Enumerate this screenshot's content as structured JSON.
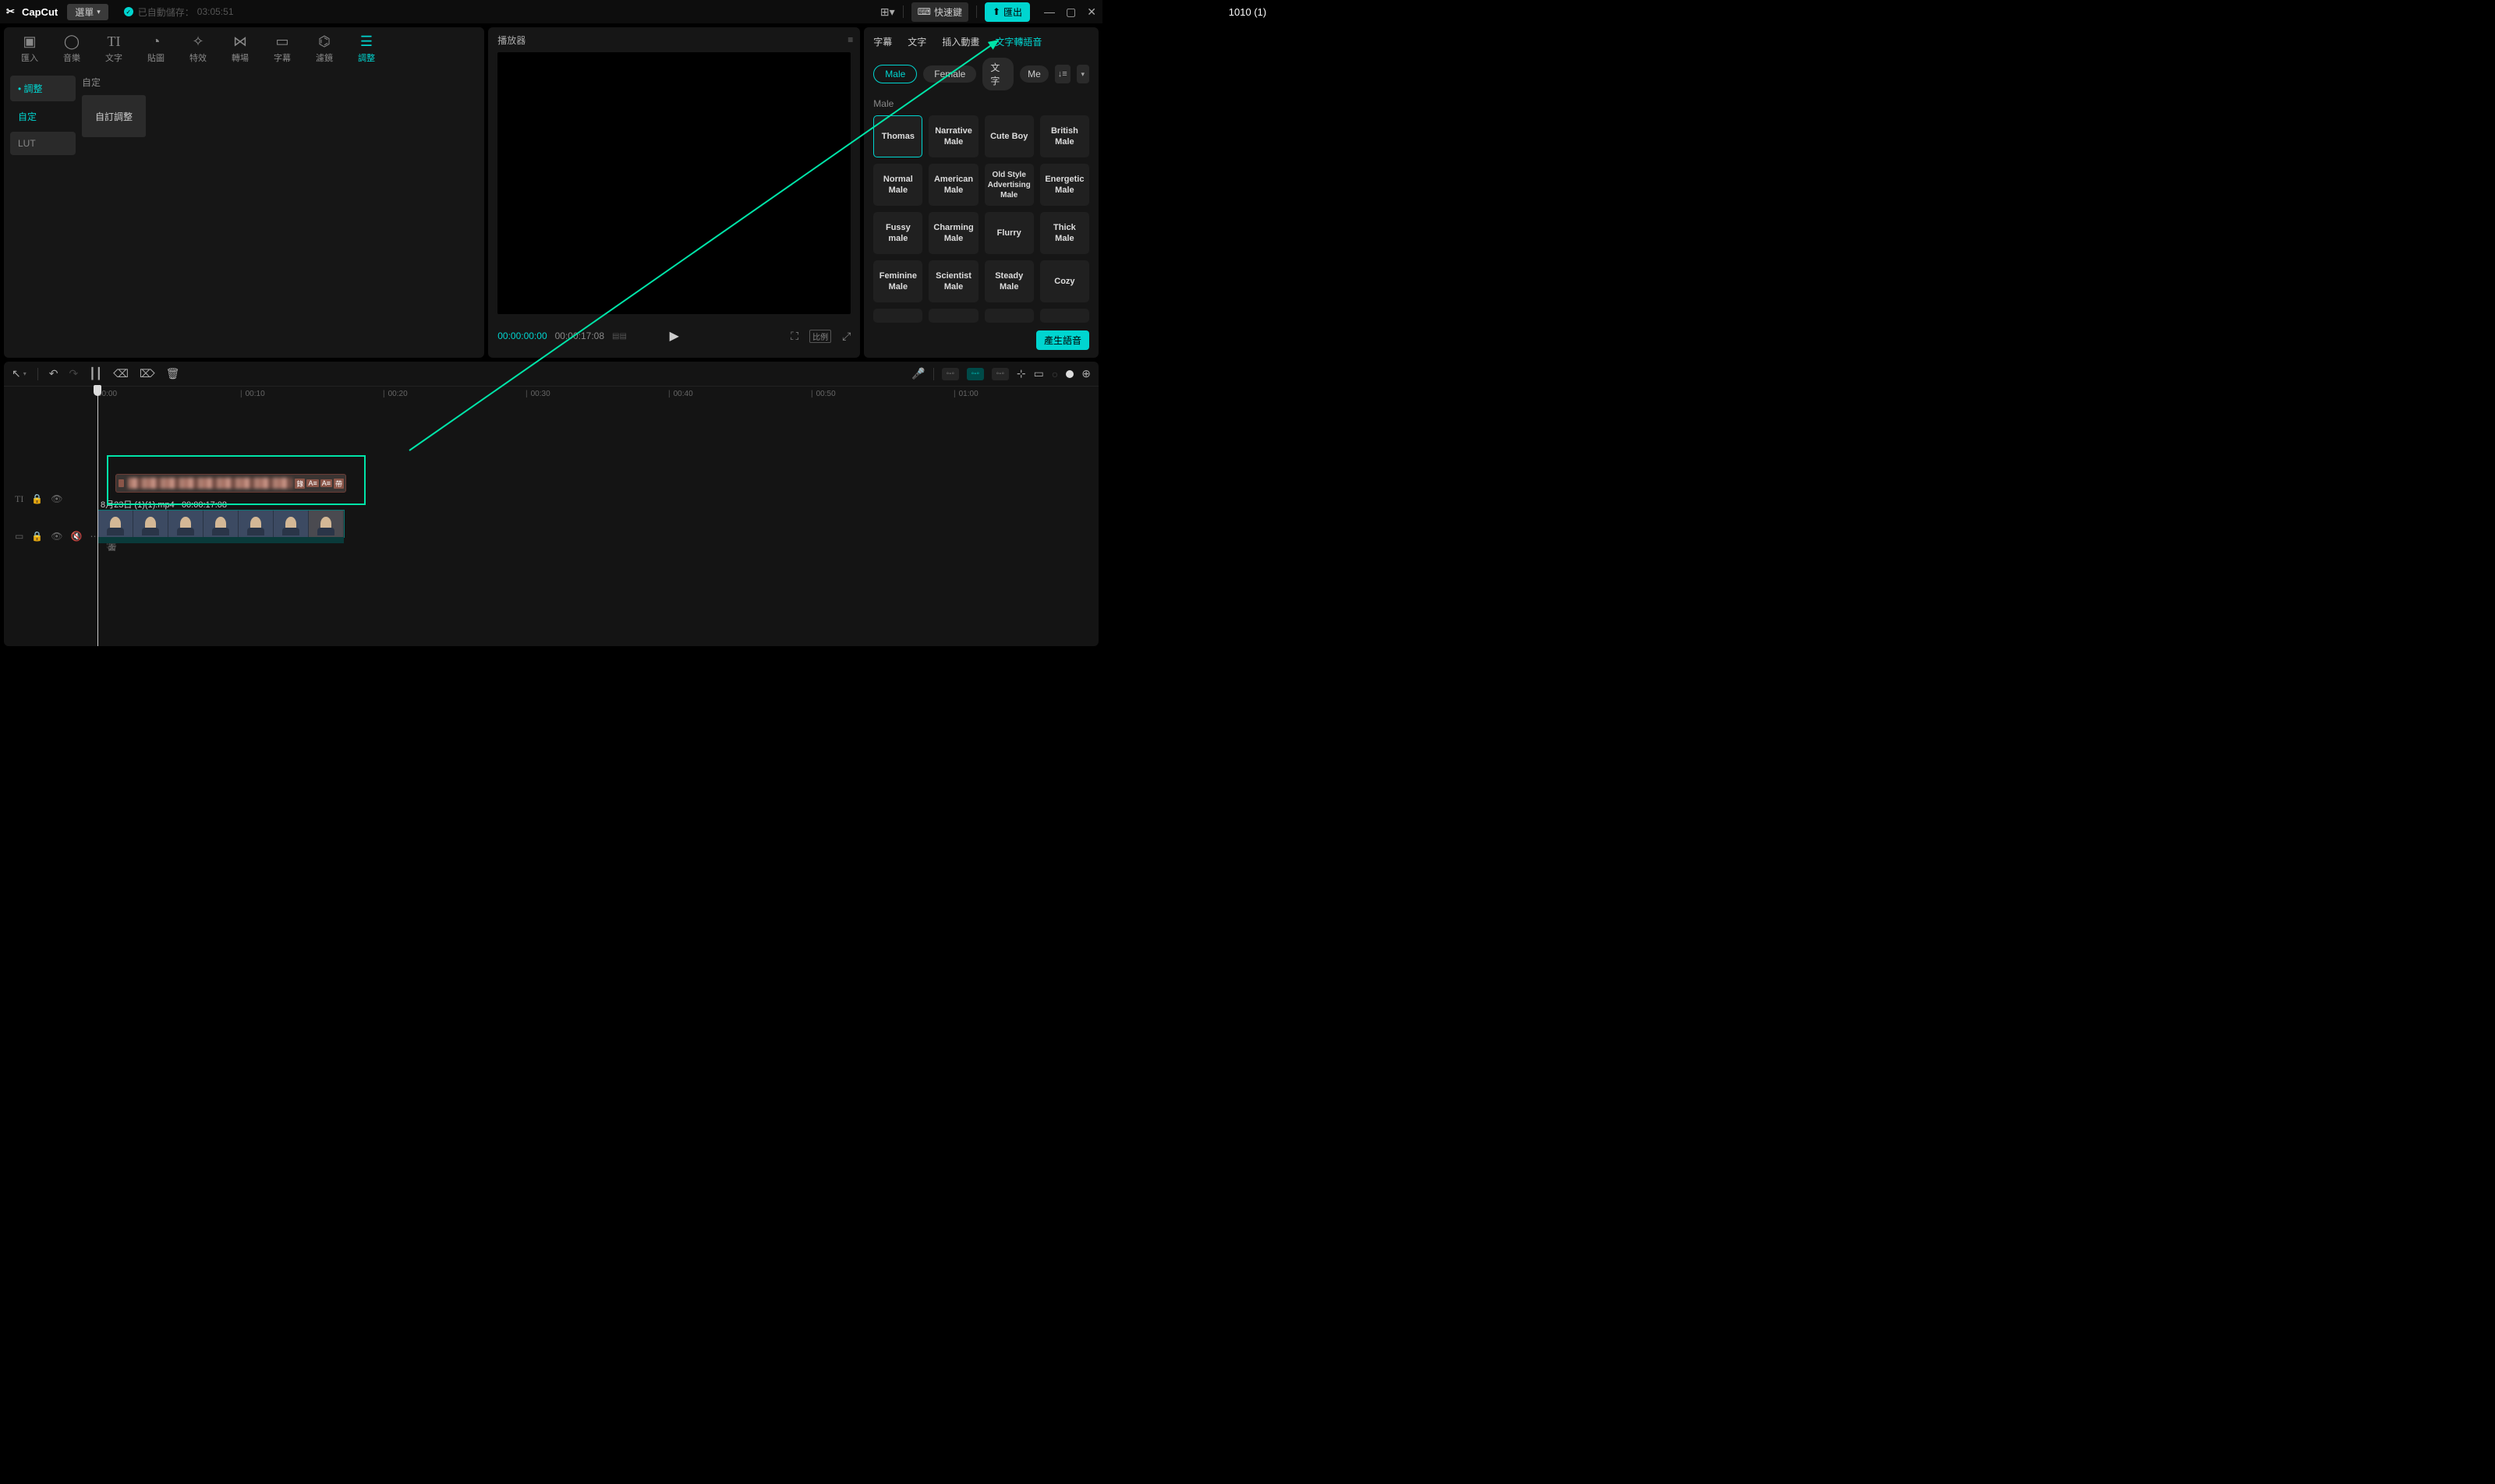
{
  "titlebar": {
    "brand": "CapCut",
    "menu": "選單",
    "autosave_label": "已自動儲存：",
    "autosave_time": "03:05:51",
    "project_title": "1010 (1)",
    "shortcut": "快速鍵",
    "export": "匯出"
  },
  "media_tabs": [
    {
      "icon": "⎘",
      "label": "匯入"
    },
    {
      "icon": "♪",
      "label": "音樂"
    },
    {
      "icon": "T",
      "label": "文字"
    },
    {
      "icon": "◷",
      "label": "貼圖"
    },
    {
      "icon": "✦",
      "label": "特效"
    },
    {
      "icon": "⋈",
      "label": "轉場"
    },
    {
      "icon": "▭",
      "label": "字幕"
    },
    {
      "icon": "⌬",
      "label": "濾鏡"
    },
    {
      "icon": "≛",
      "label": "調整",
      "active": true
    }
  ],
  "left_sidebar": {
    "items": [
      {
        "label": "調整",
        "style": "active"
      },
      {
        "label": "自定",
        "style": "selected"
      },
      {
        "label": "LUT",
        "style": "lut"
      }
    ]
  },
  "left_content": {
    "section": "自定",
    "card": "自訂調整"
  },
  "player": {
    "header": "播放器",
    "time_current": "00:00:00:00",
    "time_total": "00:00:17:08",
    "ratio": "比例"
  },
  "right_panel": {
    "tabs": [
      "字幕",
      "文字",
      "插入動畫",
      "文字轉語音"
    ],
    "active_tab": 3,
    "filters": [
      "Male",
      "Female",
      "文字",
      "Me"
    ],
    "active_filter": 0,
    "section_label": "Male",
    "voices_selected": "Thomas",
    "voices": [
      [
        "Thomas",
        "Narrative Male",
        "Cute Boy",
        "British Male"
      ],
      [
        "Normal Male",
        "American Male",
        "Old Style Advertising Male",
        "Energetic Male"
      ],
      [
        "Fussy male",
        "Charming Male",
        "Flurry",
        "Thick Male"
      ],
      [
        "Feminine Male",
        "Scientist Male",
        "Steady Male",
        "Cozy"
      ]
    ],
    "generate": "產生語音"
  },
  "timeline": {
    "ruler": [
      "00:00",
      "00:10",
      "00:20",
      "00:30",
      "00:40",
      "00:50",
      "01:00"
    ],
    "text_track_tags": [
      "錄",
      "A≡",
      "A≡",
      "帶"
    ],
    "video_name": "8月23日 (1)(1).mp4",
    "video_duration": "00:00:17:08",
    "cover": "封面"
  }
}
